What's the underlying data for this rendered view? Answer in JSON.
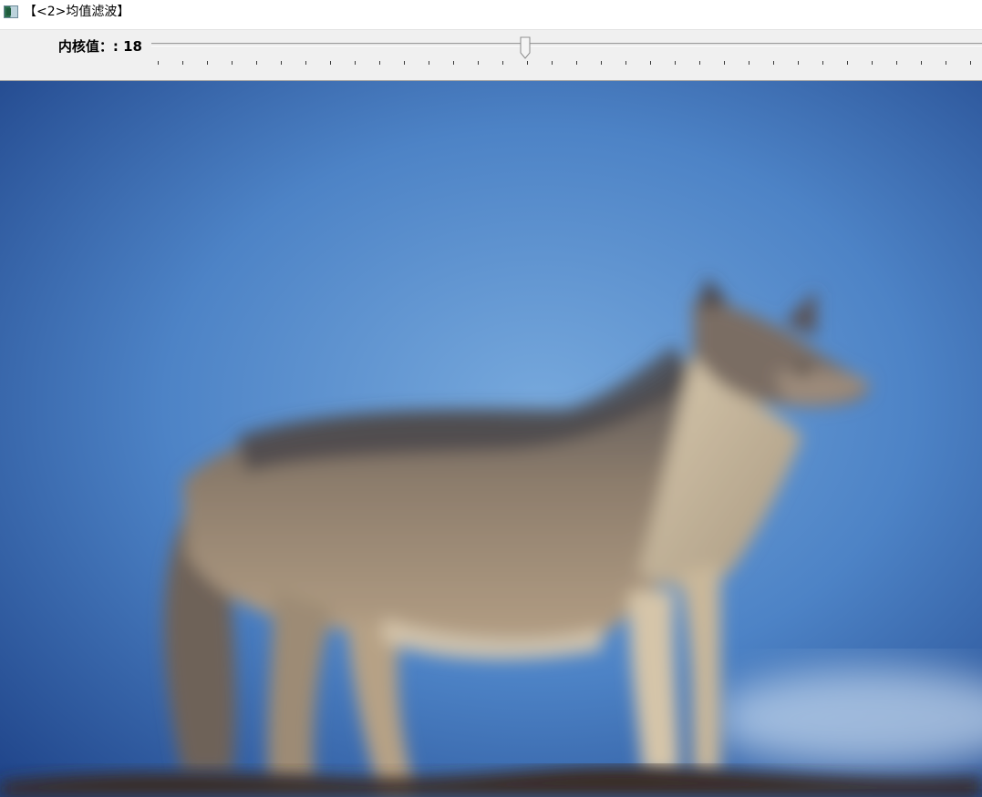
{
  "window": {
    "title": "【<2>均值滤波】",
    "icon": "opencv-window-icon"
  },
  "trackbar": {
    "label": "内核值：: 18",
    "value": 18,
    "min": 0,
    "max": 40,
    "tick_count": 34
  },
  "image": {
    "description_icon": "wolf-photo",
    "filter": "mean-blur",
    "colors": {
      "sky_dark": "#1b3f85",
      "sky_light": "#6aa0d8",
      "wolf_body": "#9c8a74",
      "wolf_dark": "#4e4c4e",
      "ground": "#3a2a22"
    }
  }
}
